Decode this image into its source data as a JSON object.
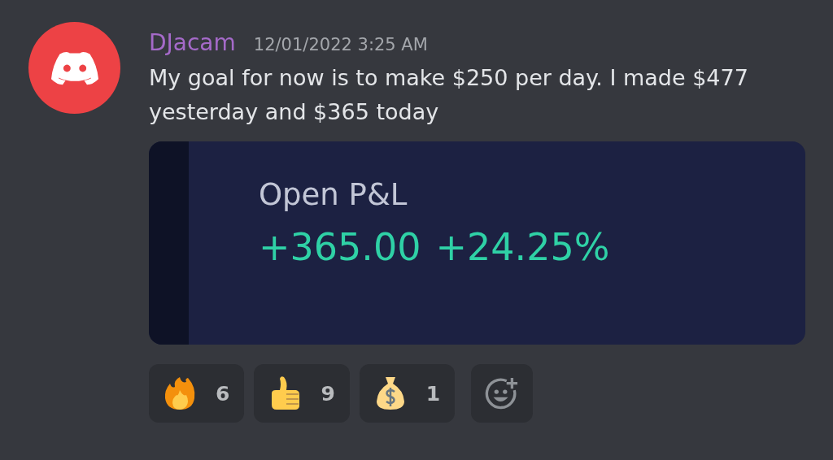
{
  "message": {
    "author": "DJacam",
    "timestamp": "12/01/2022 3:25 AM",
    "text": "My goal for now is to make $250 per day. I made $477 yesterday and $365 today"
  },
  "attachment": {
    "title": "Open P&L",
    "amount": "+365.00",
    "percent": "+24.25%"
  },
  "reactions": [
    {
      "kind": "fire",
      "count": "6"
    },
    {
      "kind": "thumbs-up",
      "count": "9"
    },
    {
      "kind": "money-bag",
      "count": "1"
    }
  ]
}
